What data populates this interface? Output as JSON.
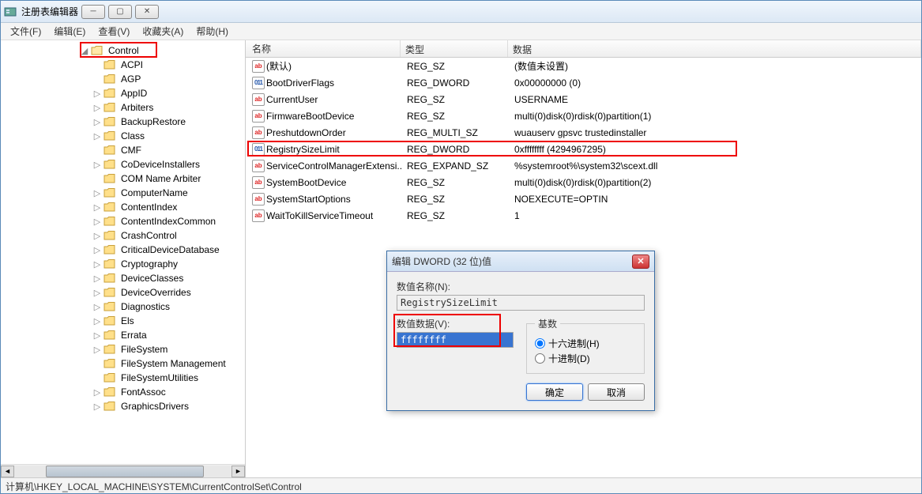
{
  "titlebar": {
    "title": "注册表编辑器"
  },
  "menu": {
    "file": "文件(F)",
    "edit": "编辑(E)",
    "view": "查看(V)",
    "favorites": "收藏夹(A)",
    "help": "帮助(H)"
  },
  "tree": {
    "selected": "Control",
    "children": [
      "ACPI",
      "AGP",
      "AppID",
      "Arbiters",
      "BackupRestore",
      "Class",
      "CMF",
      "CoDeviceInstallers",
      "COM Name Arbiter",
      "ComputerName",
      "ContentIndex",
      "ContentIndexCommon",
      "CrashControl",
      "CriticalDeviceDatabase",
      "Cryptography",
      "DeviceClasses",
      "DeviceOverrides",
      "Diagnostics",
      "Els",
      "Errata",
      "FileSystem",
      "FileSystem Management",
      "FileSystemUtilities",
      "FontAssoc",
      "GraphicsDrivers"
    ],
    "expandable": {
      "AppID": true,
      "Arbiters": true,
      "BackupRestore": true,
      "Class": true,
      "CoDeviceInstallers": true,
      "ComputerName": true,
      "ContentIndex": true,
      "ContentIndexCommon": true,
      "CrashControl": true,
      "CriticalDeviceDatabase": true,
      "Cryptography": true,
      "DeviceClasses": true,
      "DeviceOverrides": true,
      "Diagnostics": true,
      "Els": true,
      "Errata": true,
      "FileSystem": true,
      "FontAssoc": true,
      "GraphicsDrivers": true
    }
  },
  "list": {
    "headers": {
      "name": "名称",
      "type": "类型",
      "data": "数据"
    },
    "rows": [
      {
        "icon": "ab",
        "name": "(默认)",
        "type": "REG_SZ",
        "data": "(数值未设置)"
      },
      {
        "icon": "bin",
        "name": "BootDriverFlags",
        "type": "REG_DWORD",
        "data": "0x00000000 (0)"
      },
      {
        "icon": "ab",
        "name": "CurrentUser",
        "type": "REG_SZ",
        "data": "USERNAME"
      },
      {
        "icon": "ab",
        "name": "FirmwareBootDevice",
        "type": "REG_SZ",
        "data": "multi(0)disk(0)rdisk(0)partition(1)"
      },
      {
        "icon": "ab",
        "name": "PreshutdownOrder",
        "type": "REG_MULTI_SZ",
        "data": "wuauserv gpsvc trustedinstaller"
      },
      {
        "icon": "bin",
        "name": "RegistrySizeLimit",
        "type": "REG_DWORD",
        "data": "0xffffffff (4294967295)",
        "highlight": true
      },
      {
        "icon": "ab",
        "name": "ServiceControlManagerExtensi..",
        "type": "REG_EXPAND_SZ",
        "data": "%systemroot%\\system32\\scext.dll"
      },
      {
        "icon": "ab",
        "name": "SystemBootDevice",
        "type": "REG_SZ",
        "data": "multi(0)disk(0)rdisk(0)partition(2)"
      },
      {
        "icon": "ab",
        "name": "SystemStartOptions",
        "type": "REG_SZ",
        "data": " NOEXECUTE=OPTIN"
      },
      {
        "icon": "ab",
        "name": "WaitToKillServiceTimeout",
        "type": "REG_SZ",
        "data": "1"
      }
    ]
  },
  "dialog": {
    "title": "编辑 DWORD (32 位)值",
    "name_label": "数值名称(N):",
    "name_value": "RegistrySizeLimit",
    "data_label": "数值数据(V):",
    "data_value": "ffffffff",
    "base_label": "基数",
    "hex_label": "十六进制(H)",
    "dec_label": "十进制(D)",
    "ok": "确定",
    "cancel": "取消"
  },
  "statusbar": {
    "path": "计算机\\HKEY_LOCAL_MACHINE\\SYSTEM\\CurrentControlSet\\Control"
  }
}
